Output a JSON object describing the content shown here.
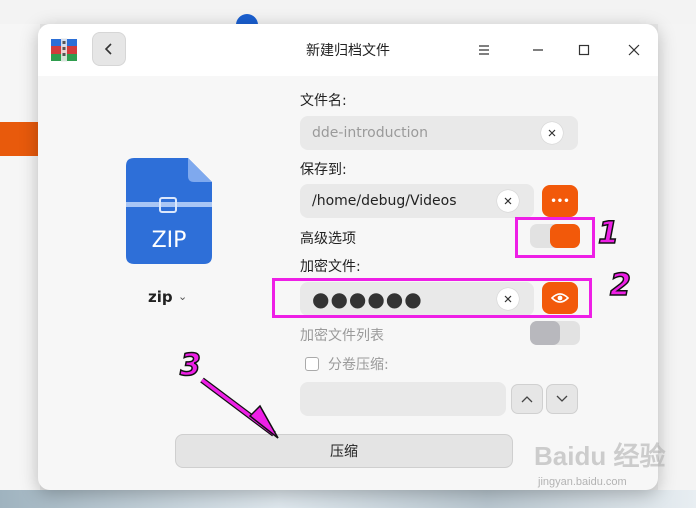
{
  "dialog": {
    "title": "新建归档文件",
    "back_icon": "chevron-left-icon",
    "menu_icon": "hamburger-icon",
    "maximize_icon": "maximize-icon",
    "close_icon": "close-icon"
  },
  "archive": {
    "icon_text": "ZIP",
    "type": "zip"
  },
  "form": {
    "filename_label": "文件名:",
    "filename_value": "dde-introduction",
    "save_label": "保存到:",
    "save_value": "/home/debug/Videos",
    "browse_label": "•••",
    "advanced_label": "高级选项",
    "advanced_on": true,
    "encrypt_label": "加密文件:",
    "password_mask": "●●●●●●",
    "encrypt_list_label": "加密文件列表",
    "encrypt_list_on": false,
    "split_label": "分卷压缩:",
    "split_checked": false,
    "split_value": ""
  },
  "actions": {
    "compress_label": "压缩"
  },
  "annotations": {
    "n1": "1",
    "n2": "2",
    "n3": "3"
  },
  "watermark": {
    "text": "Baidu 经验",
    "sub": "jingyan.baidu.com"
  },
  "colors": {
    "accent": "#f2590a",
    "highlight": "#ee1fe6"
  }
}
